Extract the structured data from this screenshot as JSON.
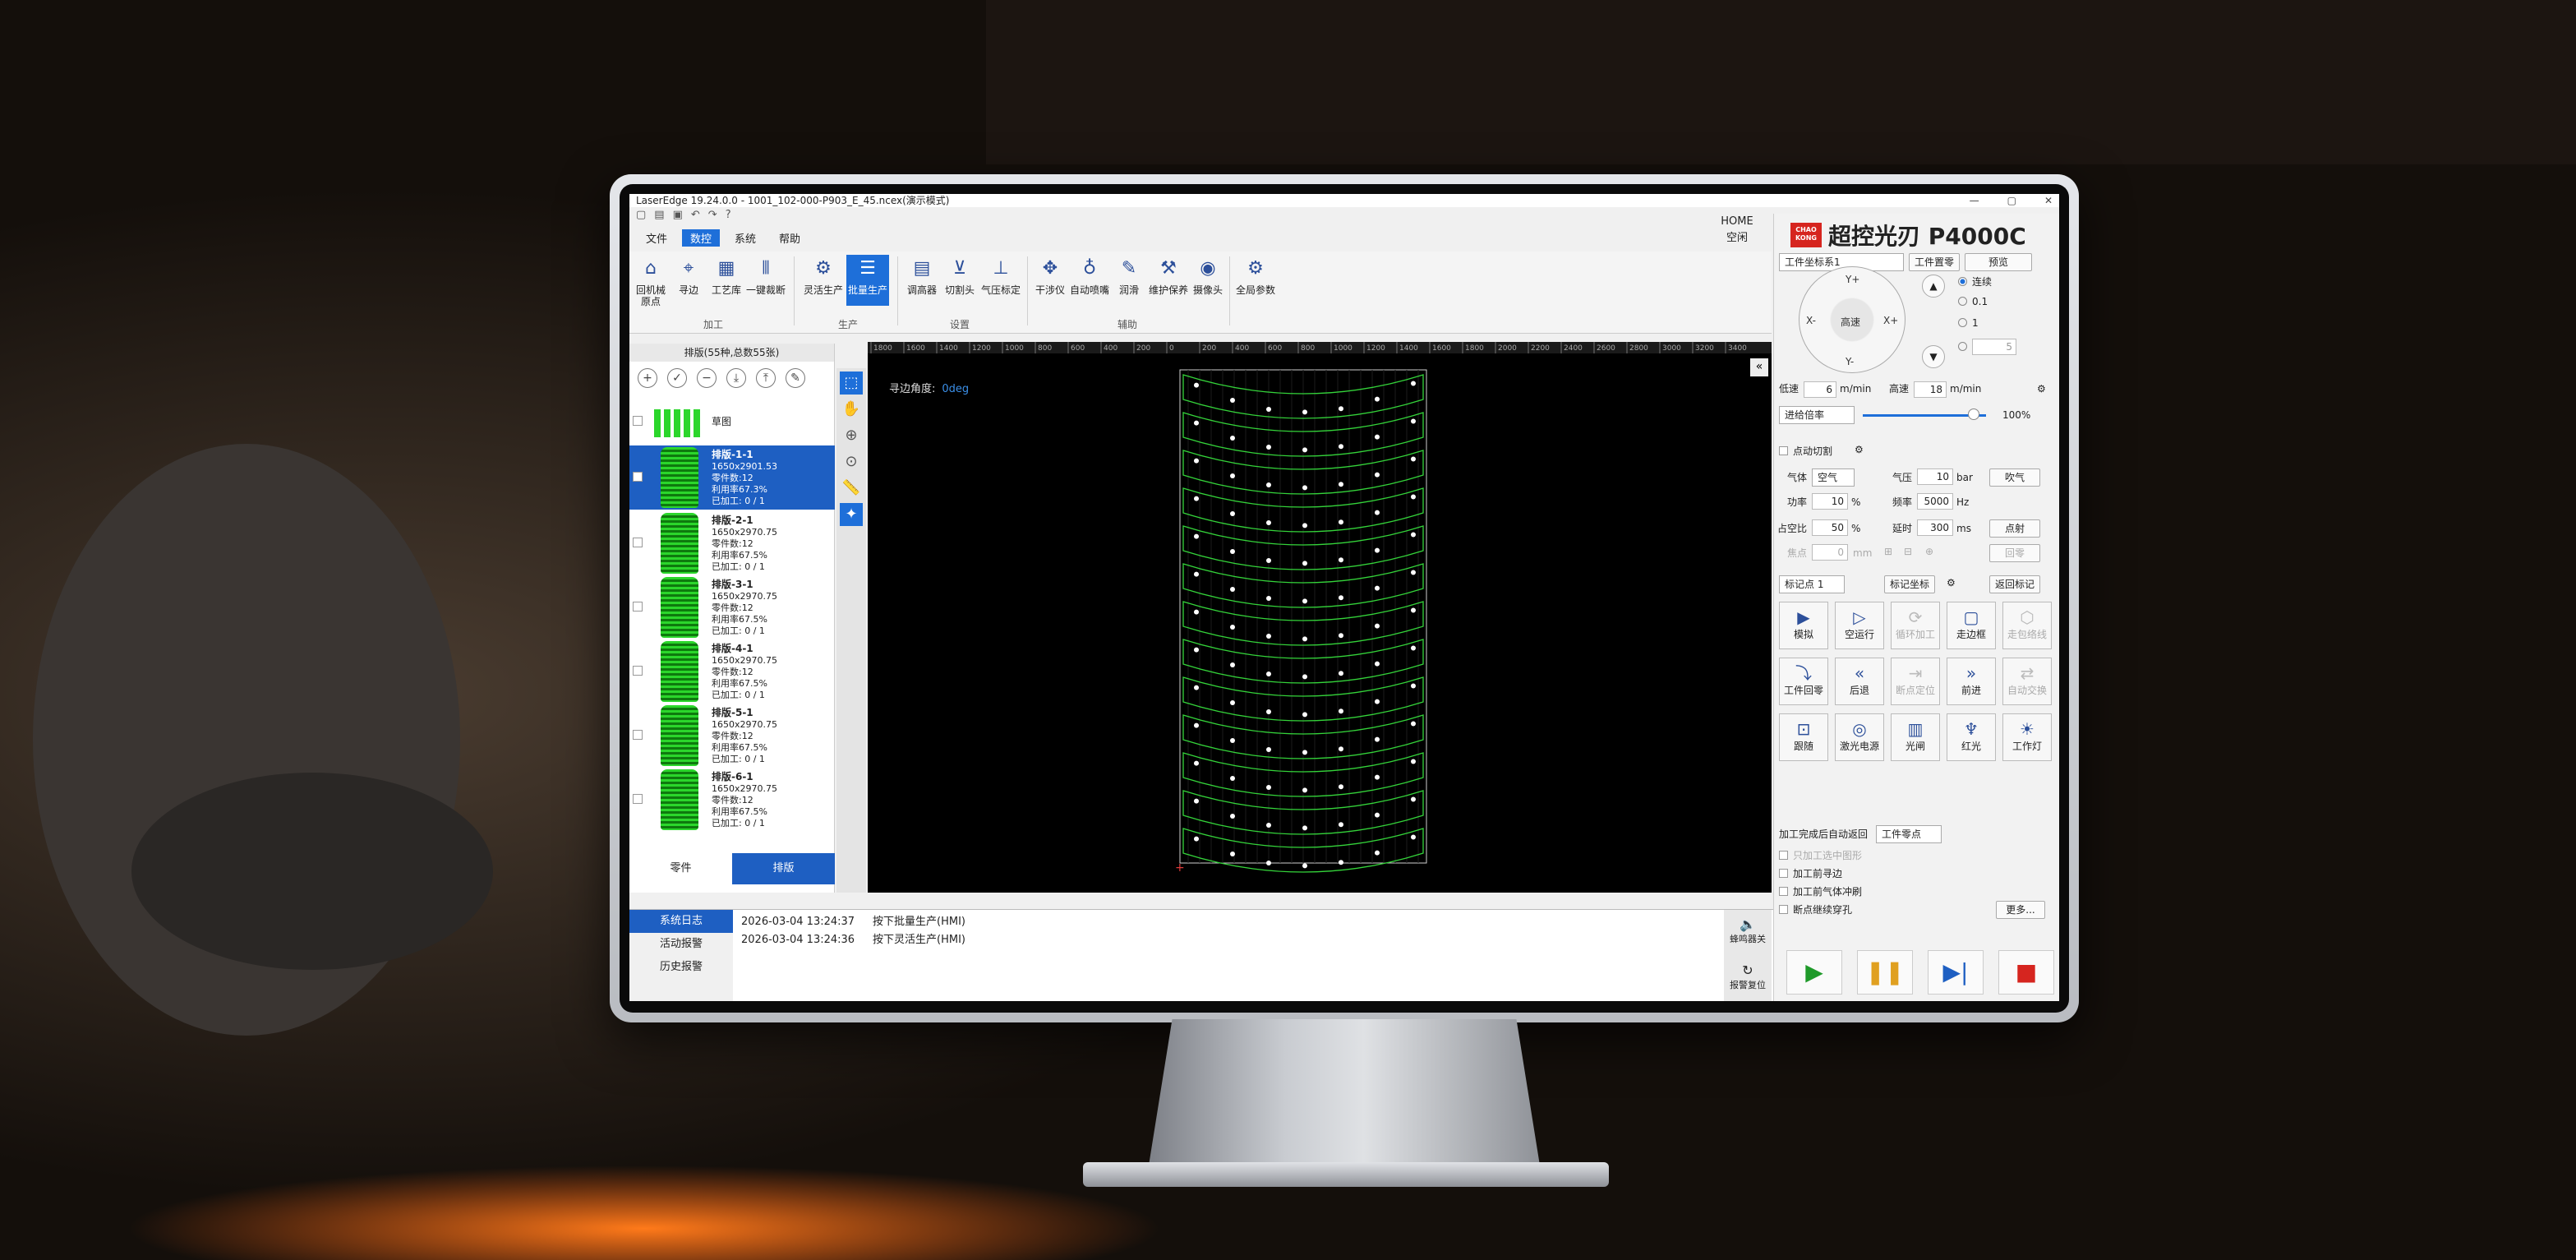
{
  "window": {
    "title": "LaserEdge 19.24.0.0 - 1001_102-000-P903_E_45.ncex(演示模式)",
    "controls": [
      "—",
      "▢",
      "✕"
    ]
  },
  "menu": [
    "文件",
    "数控",
    "系统",
    "帮助"
  ],
  "menu_active": "数控",
  "home": {
    "line1": "HOME",
    "line2": "空闲"
  },
  "ribbon": {
    "buttons": [
      "回机械原点",
      "寻边",
      "工艺库",
      "一键裁断",
      "灵活生产",
      "批量生产",
      "调高器",
      "切割头",
      "气压标定",
      "干涉仪",
      "自动喷嘴",
      "润滑",
      "维护保养",
      "摄像头",
      "全局参数"
    ],
    "active": "批量生产",
    "groups": [
      "加工",
      "生产",
      "设置",
      "辅助"
    ]
  },
  "nest_panel": {
    "header": "排版(55种,总数55张)",
    "sketch_label": "草图",
    "cards": [
      {
        "name": "排版-1-1",
        "size": "1650x2901.53",
        "parts": "零件数:12",
        "util": "利用率67.3%",
        "done": "已加工: 0 / 1"
      },
      {
        "name": "排版-2-1",
        "size": "1650x2970.75",
        "parts": "零件数:12",
        "util": "利用率67.5%",
        "done": "已加工: 0 / 1"
      },
      {
        "name": "排版-3-1",
        "size": "1650x2970.75",
        "parts": "零件数:12",
        "util": "利用率67.5%",
        "done": "已加工: 0 / 1"
      },
      {
        "name": "排版-4-1",
        "size": "1650x2970.75",
        "parts": "零件数:12",
        "util": "利用率67.5%",
        "done": "已加工: 0 / 1"
      },
      {
        "name": "排版-5-1",
        "size": "1650x2970.75",
        "parts": "零件数:12",
        "util": "利用率67.5%",
        "done": "已加工: 0 / 1"
      },
      {
        "name": "排版-6-1",
        "size": "1650x2970.75",
        "parts": "零件数:12",
        "util": "利用率67.5%",
        "done": "已加工: 0 / 1"
      }
    ],
    "tabs": [
      "零件",
      "排版"
    ],
    "tab_active": "排版"
  },
  "canvas": {
    "edge_angle_label": "寻边角度:",
    "edge_angle_value": "0deg",
    "ruler_ticks": [
      "1800",
      "1600",
      "1400",
      "1200",
      "1000",
      "800",
      "600",
      "400",
      "200",
      "0",
      "200",
      "400",
      "600",
      "800",
      "1000",
      "1200",
      "1400",
      "1600",
      "1800",
      "2000",
      "2200",
      "2400",
      "2600",
      "2800",
      "3000",
      "3200",
      "3400"
    ]
  },
  "control_panel": {
    "brand_logo": "CHAO KONG",
    "brand": "超控光刃 P4000C",
    "coord_select": "工件坐标系1",
    "btn_workzero": "工件置零",
    "btn_preview": "预览",
    "jog": {
      "yplus": "Y+",
      "yminus": "Y-",
      "xminus": "X-",
      "xplus": "X+",
      "center": "高速"
    },
    "step_options": [
      "连续",
      "0.1",
      "1",
      "5"
    ],
    "low_speed_label": "低速",
    "low_speed": "6",
    "high_speed_label": "高速",
    "high_speed": "18",
    "speed_unit": "m/min",
    "feed_rate_select": "进给倍率",
    "feed_rate": "100%",
    "dot_cut": "点动切割",
    "gas_label": "气体",
    "gas_value": "空气",
    "pressure_label": "气压",
    "pressure_value": "10",
    "pressure_unit": "bar",
    "btn_blow": "吹气",
    "power_label": "功率",
    "power_value": "10",
    "power_unit": "%",
    "freq_label": "频率",
    "freq_value": "5000",
    "freq_unit": "Hz",
    "duty_label": "占空比",
    "duty_value": "50",
    "duty_unit": "%",
    "delay_label": "延时",
    "delay_value": "300",
    "delay_unit": "ms",
    "btn_shot": "点射",
    "focus_label": "焦点",
    "focus_value": "0",
    "focus_unit": "mm",
    "btn_back": "回零",
    "marker_select": "标记点 1",
    "btn_mark": "标记坐标",
    "btn_return_mark": "返回标记",
    "ops": [
      "模拟",
      "空运行",
      "循环加工",
      "走边框",
      "走包络线",
      "工件回零",
      "后退",
      "断点定位",
      "前进",
      "自动交换",
      "跟随",
      "激光电源",
      "光闸",
      "红光",
      "工作灯"
    ],
    "after_label": "加工完成后自动返回",
    "after_value": "工件零点",
    "checks": [
      "只加工选中图形",
      "加工前寻边",
      "加工前气体冲刷",
      "断点继续穿孔"
    ],
    "btn_more": "更多..."
  },
  "log": {
    "tabs": [
      "系统日志",
      "活动报警",
      "历史报警"
    ],
    "entries": [
      {
        "time": "2026-03-04 13:24:37",
        "msg": "按下批量生产(HMI)"
      },
      {
        "time": "2026-03-04 13:24:36",
        "msg": "按下灵活生产(HMI)"
      }
    ],
    "side_buttons": [
      "蜂鸣器关",
      "报警复位"
    ]
  },
  "colors": {
    "accent": "#1e6fd9",
    "cut_path": "#34d43a",
    "brand_red": "#d6251f"
  }
}
